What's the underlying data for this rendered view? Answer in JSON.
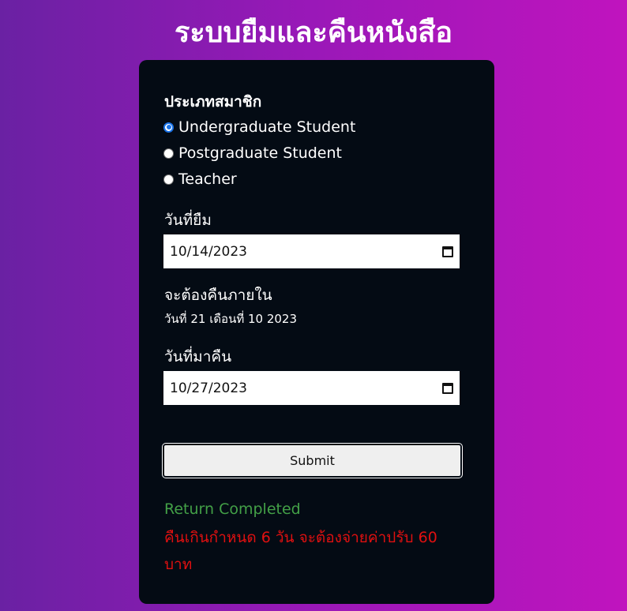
{
  "page": {
    "title": "ระบบยืมและคืนหนังสือ"
  },
  "form": {
    "member_type_label": "ประเภทสมาชิก",
    "member_options": [
      {
        "label": "Undergraduate Student",
        "checked": true
      },
      {
        "label": "Postgraduate Student",
        "checked": false
      },
      {
        "label": "Teacher",
        "checked": false
      }
    ],
    "borrow_date_label": "วันที่ยืม",
    "borrow_date_value": "10/14/2023",
    "due_label": "จะต้องคืนภายใน",
    "due_text": "วันที่ 21 เดือนที่ 10 2023",
    "return_date_label": "วันที่มาคืน",
    "return_date_value": "10/27/2023",
    "submit_label": "Submit"
  },
  "result": {
    "status": "Return Completed",
    "fine_message": "คืนเกินกำหนด 6 วัน จะต้องจ่ายค่าปรับ 60 บาท"
  },
  "colors": {
    "accent": "#1a73e8",
    "success": "#43a047",
    "error": "#e01010",
    "card_bg": "#040b14"
  },
  "icons": {
    "calendar": "calendar-icon"
  }
}
